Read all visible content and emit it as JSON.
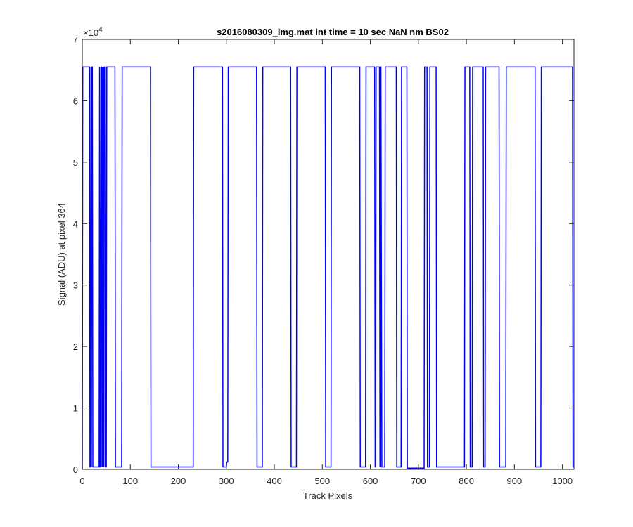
{
  "chart_data": {
    "type": "line",
    "title": "s2016080309_img.mat int time = 10 sec  NaN nm BS02",
    "xlabel": "Track Pixels",
    "ylabel": "Signal (ADU) at pixel 364",
    "xlim": [
      0,
      1024
    ],
    "ylim": [
      0,
      70000
    ],
    "x_ticks": [
      0,
      100,
      200,
      300,
      400,
      500,
      600,
      700,
      800,
      900,
      1000
    ],
    "x_tick_labels": [
      "0",
      "100",
      "200",
      "300",
      "400",
      "500",
      "600",
      "700",
      "800",
      "900",
      "1000"
    ],
    "y_ticks": [
      0,
      10000,
      20000,
      30000,
      40000,
      50000,
      60000,
      70000
    ],
    "y_tick_labels": [
      "0",
      "1",
      "2",
      "3",
      "4",
      "5",
      "6",
      "7"
    ],
    "y_exponent_label": "×10",
    "y_exponent_power": "4",
    "grid": false,
    "line_color": "#0000ff",
    "series": [
      {
        "x": [
          0,
          1,
          2,
          15,
          16,
          17,
          18,
          19,
          20,
          21,
          22,
          24,
          25,
          35,
          36,
          37,
          38,
          39,
          40,
          41,
          42,
          43,
          44,
          45,
          46,
          47,
          48,
          49,
          50,
          51,
          52,
          68,
          69,
          82,
          83,
          142,
          143,
          231,
          232,
          292,
          293,
          300,
          301,
          303,
          304,
          363,
          364,
          375,
          376,
          434,
          435,
          446,
          447,
          506,
          507,
          518,
          519,
          578,
          579,
          590,
          591,
          609,
          610,
          611,
          612,
          619,
          620,
          621,
          622,
          624,
          625,
          630,
          631,
          654,
          655,
          664,
          665,
          676,
          677,
          712,
          713,
          718,
          719,
          723,
          724,
          737,
          738,
          796,
          797,
          807,
          808,
          812,
          813,
          835,
          836,
          839,
          840,
          844,
          845,
          868,
          869,
          882,
          883,
          943,
          944,
          955,
          956,
          1021,
          1022,
          1024
        ],
        "y": [
          0,
          65500,
          65500,
          65500,
          400,
          400,
          65500,
          400,
          65500,
          65500,
          400,
          400,
          400,
          400,
          65500,
          400,
          400,
          65500,
          65500,
          400,
          65500,
          400,
          65500,
          400,
          65500,
          65500,
          65500,
          400,
          400,
          65500,
          65500,
          65500,
          400,
          400,
          65500,
          65500,
          400,
          400,
          65500,
          65500,
          400,
          400,
          1200,
          1200,
          65500,
          65500,
          400,
          400,
          65500,
          65500,
          400,
          400,
          65500,
          65500,
          400,
          400,
          65500,
          65500,
          400,
          400,
          65500,
          65500,
          400,
          400,
          65500,
          65500,
          400,
          65500,
          65500,
          400,
          400,
          400,
          65500,
          65500,
          400,
          400,
          65500,
          65500,
          200,
          200,
          65500,
          65500,
          400,
          400,
          65500,
          65500,
          400,
          400,
          65500,
          65500,
          400,
          400,
          65500,
          65500,
          400,
          400,
          65500,
          65500,
          65500,
          65500,
          400,
          400,
          65500,
          65500,
          400,
          400,
          65500,
          65500,
          400,
          400
        ]
      }
    ]
  }
}
